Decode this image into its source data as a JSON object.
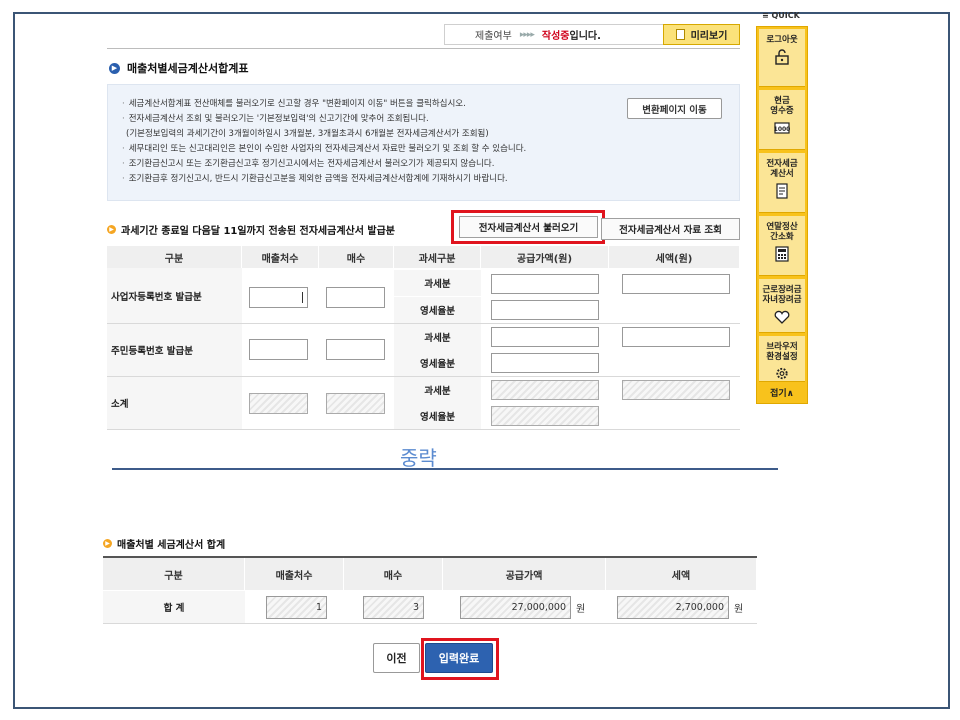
{
  "status": {
    "label": "제출여부",
    "arrows": "▸▸▸▸",
    "state": "작성중",
    "suffix": "입니다."
  },
  "preview_label": "미리보기",
  "section1_title": "매출처별세금계산서합계표",
  "info_lines": [
    "세금계산서합계표 전산매체를 불러오기로 신고할 경우 \"변환페이지 이동\" 버튼을 클릭하십시오.",
    "전자세금계산서 조회 및 불러오기는 '기본정보입력'의 신고기간에 맞추어 조회됩니다.",
    "(기본정보입력의 과세기간이 3개월이하일시 3개월분, 3개월초과시 6개월분 전자세금계산서가 조회됨)",
    "세무대리인 또는 신고대리인은 본인이 수임한 사업자의 전자세금계산서 자료만 불러오기 및 조회 할 수 있습니다.",
    "조기환급신고시 또는 조기환급신고후 정기신고시에서는 전자세금계산서 불러오기가 제공되지 않습니다.",
    "조기환급후 정기신고시, 반드시 기환급신고분을 제외한 금액을 전자세금계산서합계에 기재하시기 바랍니다."
  ],
  "convert_button": "변환페이지 이동",
  "section2_title": "과세기간 종료일 다음달 11일까지 전송된 전자세금계산서 발급분",
  "load_button": "전자세금계산서 불러오기",
  "view_button": "전자세금계산서 자료 조회",
  "table1": {
    "headers": [
      "구분",
      "매출처수",
      "매수",
      "과세구분",
      "공급가액(원)",
      "세액(원)"
    ],
    "rows": [
      "사업자등록번호 발급분",
      "주민등록번호 발급분",
      "소계"
    ],
    "sub_taxable": "과세분",
    "sub_zero": "영세율분"
  },
  "omitted_label": "중략",
  "section3_title": "매출처별 세금계산서 합계",
  "table2": {
    "headers": [
      "구분",
      "매출처수",
      "매수",
      "공급가액",
      "세액"
    ],
    "row_label": "합 계",
    "customers": "1",
    "count": "3",
    "supply": "27,000,000",
    "tax": "2,700,000",
    "unit": "원"
  },
  "prev_button": "이전",
  "done_button": "입력완료",
  "quick": {
    "title": "≡ QUICK",
    "items": [
      {
        "label": "로그아웃",
        "icon": "unlock-icon"
      },
      {
        "label": "현금\n영수증",
        "icon": "receipt-icon"
      },
      {
        "label": "전자세금\n계산서",
        "icon": "invoice-icon"
      },
      {
        "label": "연말정산\n간소화",
        "icon": "calculator-icon"
      },
      {
        "label": "근로장려금\n자녀장려금",
        "icon": "heart-icon"
      },
      {
        "label": "브라우저\n환경설정",
        "icon": "gear-icon"
      }
    ],
    "close": "접기∧"
  },
  "colors": {
    "accent_blue": "#2d62b0",
    "highlight_red": "#e0141e",
    "quick_yellow": "#f8c21c",
    "state_red": "#d0021b"
  }
}
